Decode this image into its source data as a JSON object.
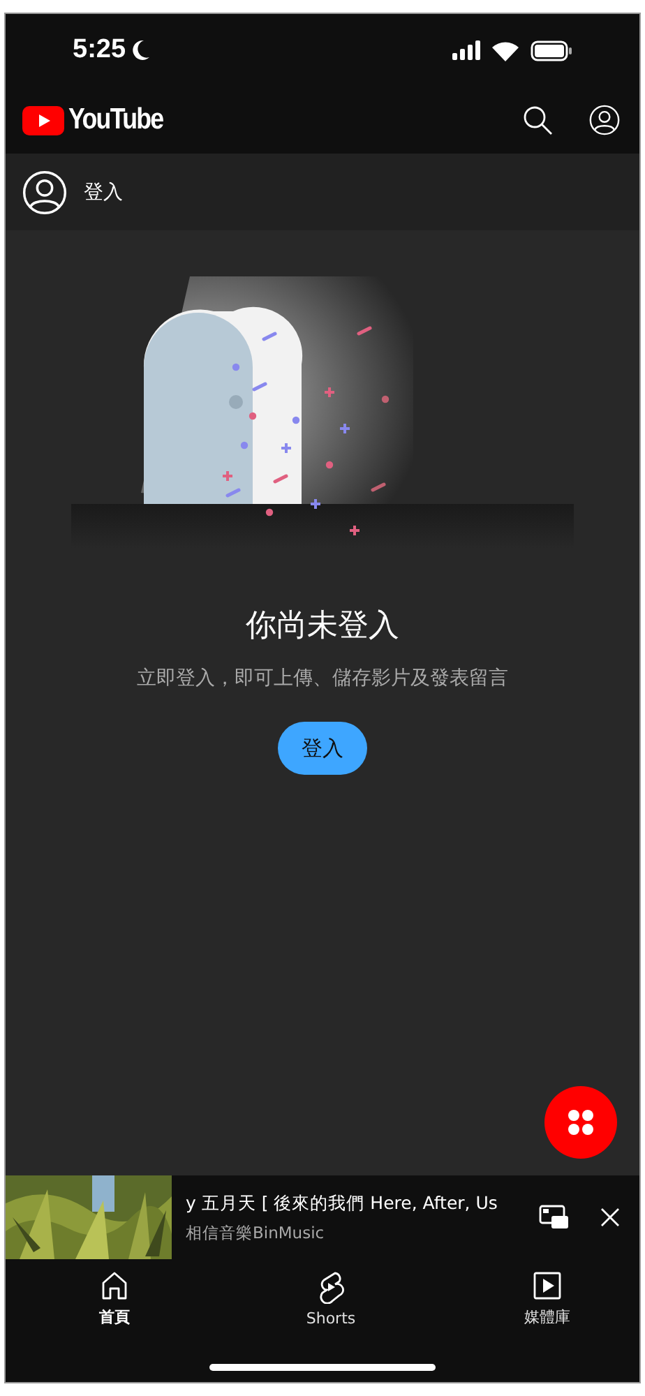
{
  "status_bar": {
    "time": "5:25"
  },
  "header": {
    "logo_text": "YouTube"
  },
  "signin_row": {
    "label": "登入"
  },
  "empty_state": {
    "title": "你尚未登入",
    "message": "立即登入，即可上傳、儲存影片及發表留言",
    "button": "登入"
  },
  "mini_player": {
    "title": "y 五月天 [ 後來的我們 Here, After, Us",
    "channel": "相信音樂BinMusic"
  },
  "bottom_nav": [
    {
      "kind": "home",
      "label": "首頁",
      "selected": true
    },
    {
      "kind": "shorts",
      "label": "Shorts",
      "selected": false
    },
    {
      "kind": "library",
      "label": "媒體庫",
      "selected": false
    }
  ]
}
